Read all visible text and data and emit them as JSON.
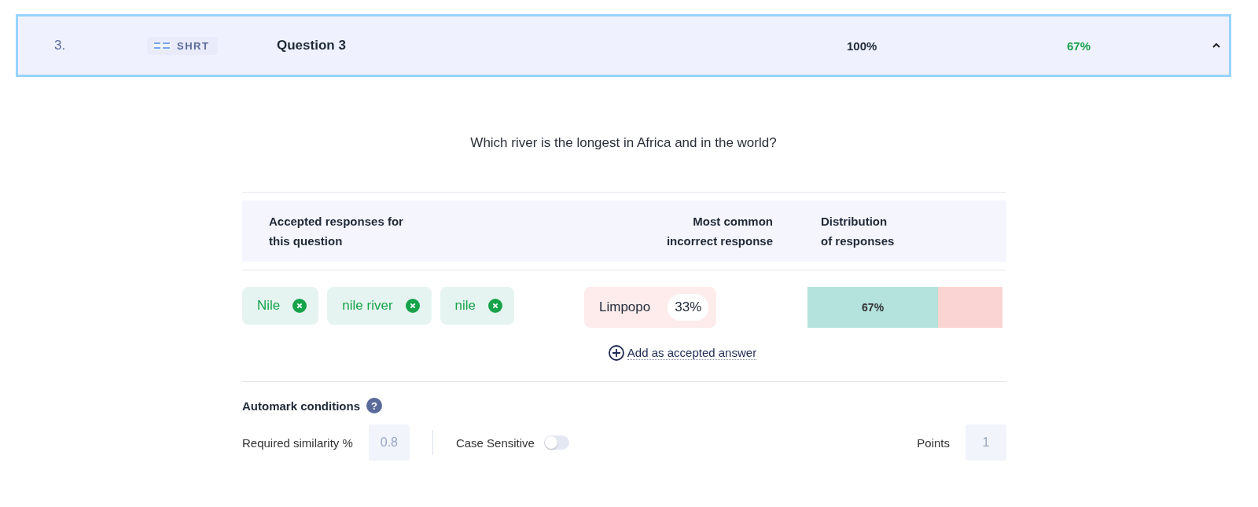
{
  "question_row": {
    "number": "3.",
    "type_label": "SHRT",
    "title": "Question 3",
    "attempted": "100%",
    "score": "67%",
    "expanded": true
  },
  "question_text": "Which river is the longest in Africa and in the world?",
  "table": {
    "columns": [
      "Accepted responses for this question",
      "Most common incorrect response",
      "Distribution of responses"
    ],
    "accepted": [
      "Nile",
      "nile river",
      "nile"
    ],
    "incorrect": {
      "answer": "Limpopo",
      "share": "33%"
    },
    "distribution": {
      "level": 0.67,
      "label": "67%"
    },
    "add_link": "Add as accepted answer"
  },
  "automark": {
    "title": "Automark conditions",
    "help_icon": "?",
    "similarity_label": "Required similarity %",
    "similarity_placeholder": "0.8",
    "case_label": "Case Sensitive",
    "case_sensitive": false,
    "points_label": "Points",
    "points_placeholder": "1"
  }
}
